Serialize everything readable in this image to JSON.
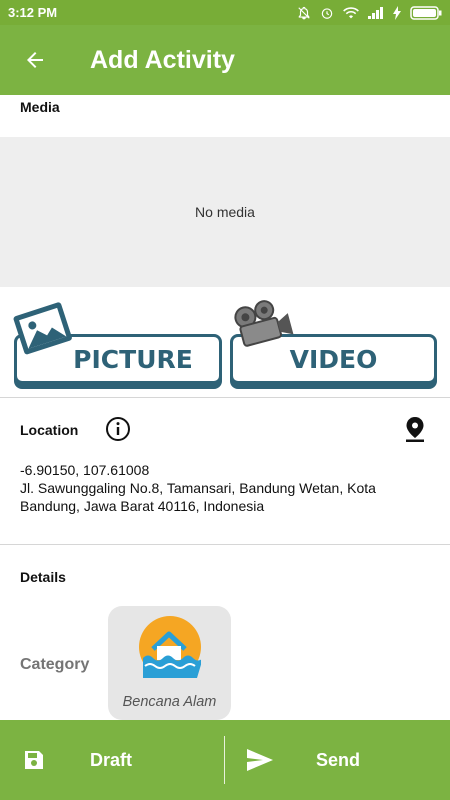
{
  "status_bar": {
    "time": "3:12 PM"
  },
  "header": {
    "title": "Add Activity",
    "back_icon": "arrow-back-icon"
  },
  "media": {
    "section_title": "Media",
    "empty_text": "No media",
    "picture_label": "PICTURE",
    "video_label": "VIDEO"
  },
  "location": {
    "section_title": "Location",
    "coordinates": "-6.90150, 107.61008",
    "address_line1": "Jl. Sawunggaling No.8, Tamansari, Bandung Wetan, Kota",
    "address_line2": "Bandung, Jawa Barat 40116, Indonesia"
  },
  "details": {
    "section_title": "Details",
    "category_label": "Category",
    "category_value": "Bencana Alam"
  },
  "bottom_bar": {
    "draft_label": "Draft",
    "send_label": "Send"
  },
  "colors": {
    "primary": "#7cb342",
    "status_bar": "#78ad37",
    "button_border": "#2e6277",
    "category_icon_bg": "#f5a623",
    "category_icon_water": "#2a9fd6"
  }
}
